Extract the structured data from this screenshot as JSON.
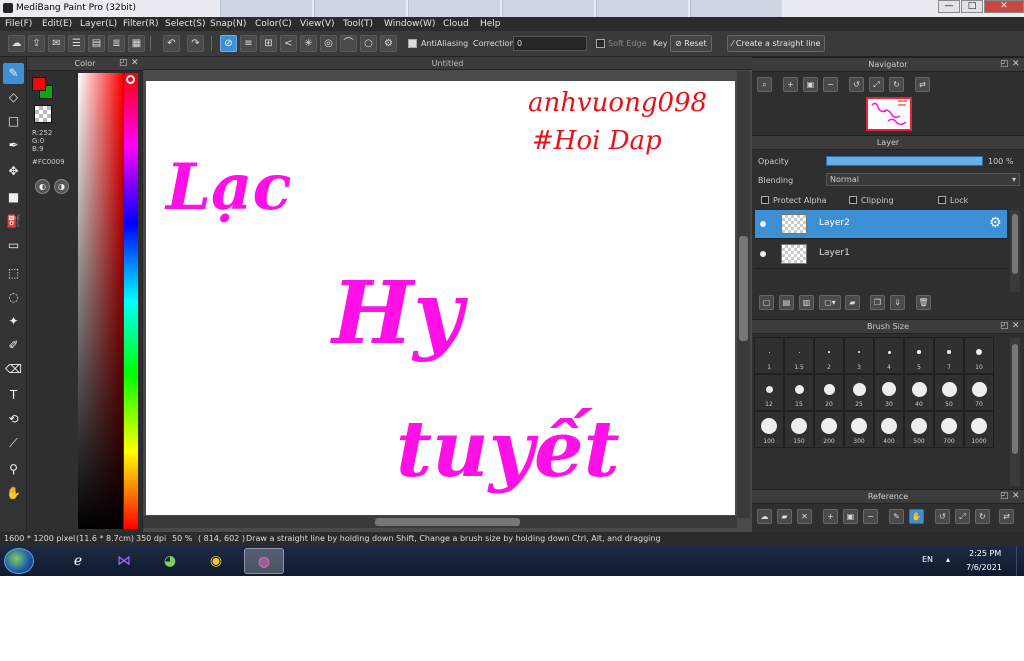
{
  "titlebar": {
    "title": "MediBang Paint Pro (32bit)",
    "min": "—",
    "max": "□",
    "close": "✕"
  },
  "menu": [
    "File(F)",
    "Edit(E)",
    "Layer(L)",
    "Filter(R)",
    "Select(S)",
    "Snap(N)",
    "Color(C)",
    "View(V)",
    "Tool(T)",
    "Window(W)",
    "Cloud",
    "Help"
  ],
  "toolbar": {
    "antialiasing_label": "AntiAliasing",
    "correction_label": "Correction",
    "correction_value": "0",
    "soft_edge_label": "Soft Edge",
    "key_label": "Key",
    "reset_label": "Reset",
    "straight_line_label": "Create a straight line"
  },
  "color_panel": {
    "title": "Color",
    "rgb": {
      "r": "R:252",
      "g": "G:0",
      "b": "B:9"
    },
    "hex": "#FC0009",
    "fg_color": "#fc0009",
    "bg_color": "#0aa80a"
  },
  "canvas": {
    "doc_title": "Untitled",
    "handwriting_top_right": [
      "anhvuong098",
      "#Hoi Dap"
    ],
    "handwriting_main": [
      "Lạc",
      "Hy",
      "tuyết"
    ]
  },
  "navigator": {
    "title": "Navigator"
  },
  "layer_panel": {
    "title": "Layer",
    "opacity_label": "Opacity",
    "opacity_value": "100 %",
    "opacity_fraction": 1.0,
    "blending_label": "Blending",
    "blending_value": "Normal",
    "protect_alpha_label": "Protect Alpha",
    "clipping_label": "Clipping",
    "lock_label": "Lock",
    "layers": [
      {
        "name": "Layer2",
        "active": true
      },
      {
        "name": "Layer1",
        "active": false
      }
    ]
  },
  "brush_size": {
    "title": "Brush Size",
    "sizes": [
      "1",
      "1.5",
      "2",
      "3",
      "4",
      "5",
      "7",
      "10",
      "12",
      "15",
      "20",
      "25",
      "30",
      "40",
      "50",
      "70",
      "100",
      "150",
      "200",
      "300",
      "400",
      "500",
      "700",
      "1000"
    ]
  },
  "reference": {
    "title": "Reference"
  },
  "status": {
    "size": "1600 * 1200 pixel",
    "physical": "(11.6 * 8.7cm)",
    "dpi": "350 dpi",
    "zoom": "50 %",
    "coords": "( 814, 602 )",
    "hint": "Draw a straight line by holding down Shift, Change a brush size by holding down Ctrl, Alt, and dragging"
  },
  "taskbar": {
    "lang": "EN",
    "time": "2:25 PM",
    "date": "7/6/2021"
  }
}
